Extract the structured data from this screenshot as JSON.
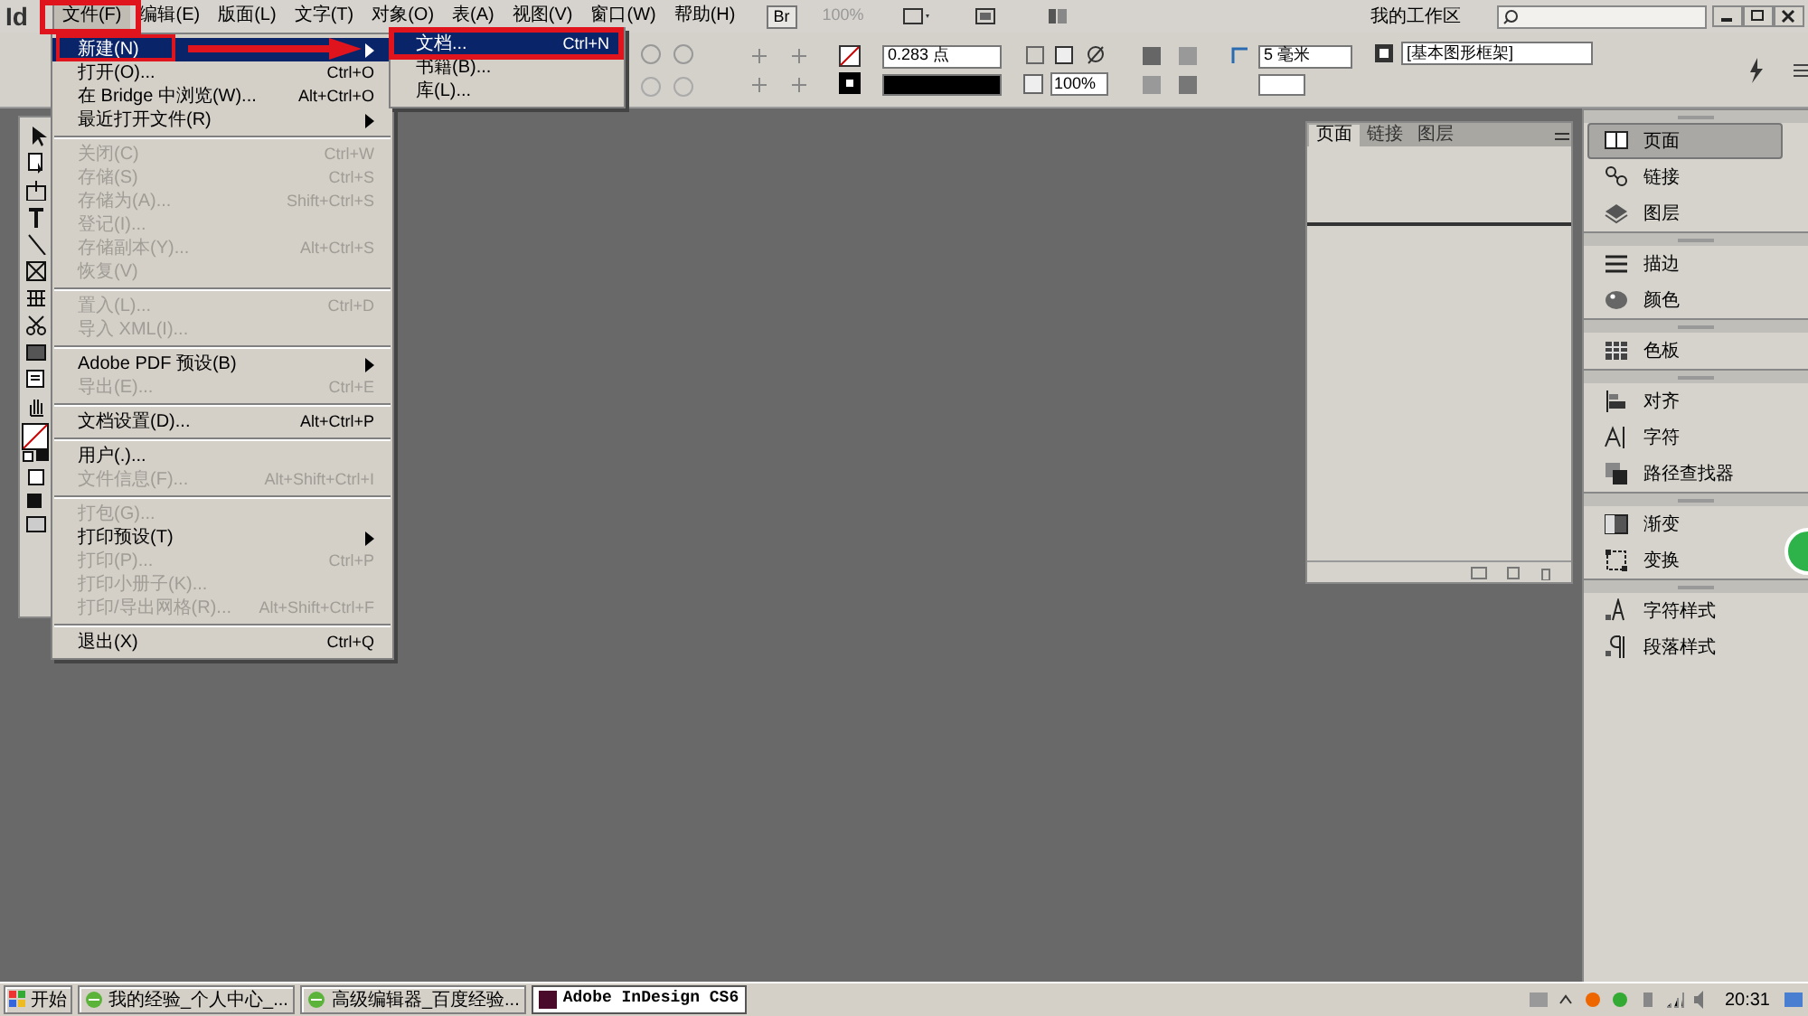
{
  "menu_bar": {
    "logo": "Id",
    "menus": [
      {
        "label": "文件(F)",
        "selected": true
      },
      {
        "label": "编辑(E)",
        "selected": false
      },
      {
        "label": "版面(L)",
        "selected": false
      },
      {
        "label": "文字(T)",
        "selected": false
      },
      {
        "label": "对象(O)",
        "selected": false
      },
      {
        "label": "表(A)",
        "selected": false
      },
      {
        "label": "视图(V)",
        "selected": false
      },
      {
        "label": "窗口(W)",
        "selected": false
      },
      {
        "label": "帮助(H)",
        "selected": false
      }
    ],
    "bridge_button": "Br",
    "zoom": "100%",
    "workspace": "我的工作区"
  },
  "control_panel": {
    "stroke_weight": "0.283 点",
    "opacity": "100%",
    "dimension": "5 毫米",
    "frame_style": "[基本图形框架]"
  },
  "file_menu": [
    {
      "kind": "item",
      "label": "新建(N)",
      "disabled": false,
      "submenu": true,
      "selected": true
    },
    {
      "kind": "item",
      "label": "打开(O)...",
      "shortcut": "Ctrl+O",
      "disabled": false,
      "submenu": false,
      "selected": false
    },
    {
      "kind": "item",
      "label": "在 Bridge 中浏览(W)...",
      "shortcut": "Alt+Ctrl+O",
      "disabled": false,
      "submenu": false,
      "selected": false
    },
    {
      "kind": "item",
      "label": "最近打开文件(R)",
      "disabled": false,
      "submenu": true,
      "selected": false
    },
    {
      "kind": "separator"
    },
    {
      "kind": "item",
      "label": "关闭(C)",
      "shortcut": "Ctrl+W",
      "disabled": true,
      "submenu": false,
      "selected": false
    },
    {
      "kind": "item",
      "label": "存储(S)",
      "shortcut": "Ctrl+S",
      "disabled": true,
      "submenu": false,
      "selected": false
    },
    {
      "kind": "item",
      "label": "存储为(A)...",
      "shortcut": "Shift+Ctrl+S",
      "disabled": true,
      "submenu": false,
      "selected": false
    },
    {
      "kind": "item",
      "label": "登记(I)...",
      "disabled": true,
      "submenu": false,
      "selected": false
    },
    {
      "kind": "item",
      "label": "存储副本(Y)...",
      "shortcut": "Alt+Ctrl+S",
      "disabled": true,
      "submenu": false,
      "selected": false
    },
    {
      "kind": "item",
      "label": "恢复(V)",
      "disabled": true,
      "submenu": false,
      "selected": false
    },
    {
      "kind": "separator"
    },
    {
      "kind": "item",
      "label": "置入(L)...",
      "shortcut": "Ctrl+D",
      "disabled": true,
      "submenu": false,
      "selected": false
    },
    {
      "kind": "item",
      "label": "导入 XML(I)...",
      "disabled": true,
      "submenu": false,
      "selected": false
    },
    {
      "kind": "separator"
    },
    {
      "kind": "item",
      "label": "Adobe PDF 预设(B)",
      "disabled": false,
      "submenu": true,
      "selected": false
    },
    {
      "kind": "item",
      "label": "导出(E)...",
      "shortcut": "Ctrl+E",
      "disabled": true,
      "submenu": false,
      "selected": false
    },
    {
      "kind": "separator"
    },
    {
      "kind": "item",
      "label": "文档设置(D)...",
      "shortcut": "Alt+Ctrl+P",
      "disabled": false,
      "submenu": false,
      "selected": false
    },
    {
      "kind": "separator"
    },
    {
      "kind": "item",
      "label": "用户(.)...",
      "disabled": false,
      "submenu": false,
      "selected": false
    },
    {
      "kind": "item",
      "label": "文件信息(F)...",
      "shortcut": "Alt+Shift+Ctrl+I",
      "disabled": true,
      "submenu": false,
      "selected": false
    },
    {
      "kind": "separator"
    },
    {
      "kind": "item",
      "label": "打包(G)...",
      "disabled": true,
      "submenu": false,
      "selected": false
    },
    {
      "kind": "item",
      "label": "打印预设(T)",
      "disabled": false,
      "submenu": true,
      "selected": false
    },
    {
      "kind": "item",
      "label": "打印(P)...",
      "shortcut": "Ctrl+P",
      "disabled": true,
      "submenu": false,
      "selected": false
    },
    {
      "kind": "item",
      "label": "打印小册子(K)...",
      "disabled": true,
      "submenu": false,
      "selected": false
    },
    {
      "kind": "item",
      "label": "打印/导出网格(R)...",
      "shortcut": "Alt+Shift+Ctrl+F",
      "disabled": true,
      "submenu": false,
      "selected": false
    },
    {
      "kind": "separator"
    },
    {
      "kind": "item",
      "label": "退出(X)",
      "shortcut": "Ctrl+Q",
      "disabled": false,
      "submenu": false,
      "selected": false
    }
  ],
  "new_submenu": [
    {
      "label": "文档...",
      "shortcut": "Ctrl+N",
      "selected": true
    },
    {
      "label": "书籍(B)...",
      "selected": false
    },
    {
      "label": "库(L)...",
      "selected": false
    }
  ],
  "pages_panel": {
    "tabs": [
      {
        "label": "页面",
        "selected": true
      },
      {
        "label": "链接",
        "selected": false
      },
      {
        "label": "图层",
        "selected": false
      }
    ]
  },
  "dock": [
    {
      "items": [
        {
          "label": "页面",
          "selected": true
        },
        {
          "label": "链接",
          "selected": false
        },
        {
          "label": "图层",
          "selected": false
        }
      ]
    },
    {
      "items": [
        {
          "label": "描边",
          "selected": false
        },
        {
          "label": "颜色",
          "selected": false
        }
      ]
    },
    {
      "items": [
        {
          "label": "色板",
          "selected": false
        }
      ]
    },
    {
      "items": [
        {
          "label": "对齐",
          "selected": false
        },
        {
          "label": "字符",
          "selected": false
        },
        {
          "label": "路径查找器",
          "selected": false
        }
      ]
    },
    {
      "items": [
        {
          "label": "渐变",
          "selected": false
        },
        {
          "label": "变换",
          "selected": false
        }
      ]
    },
    {
      "items": [
        {
          "label": "字符样式",
          "selected": false
        },
        {
          "label": "段落样式",
          "selected": false
        }
      ]
    }
  ],
  "taskbar": {
    "start": "开始",
    "tasks": [
      {
        "label": "我的经验_个人中心_...",
        "selected": false
      },
      {
        "label": "高级编辑器_百度经验...",
        "selected": false
      },
      {
        "label": "Adobe InDesign CS6",
        "selected": true
      }
    ],
    "clock": "20:31"
  }
}
